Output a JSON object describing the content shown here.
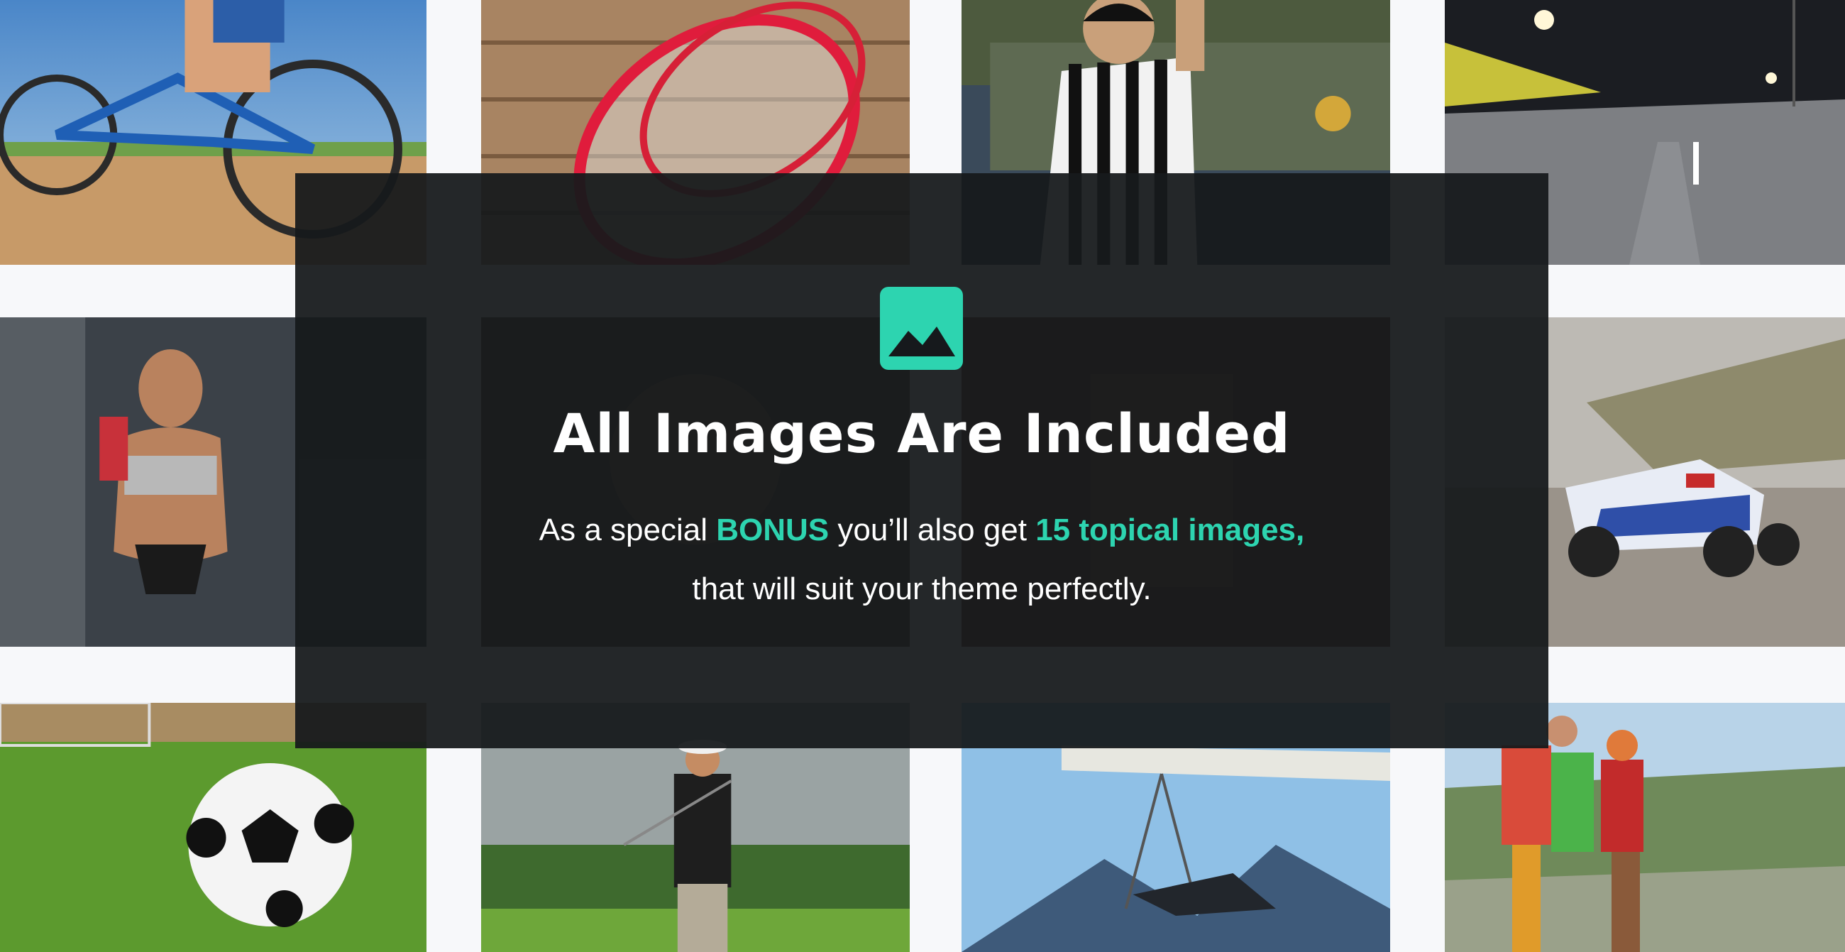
{
  "promo": {
    "icon": "image-icon",
    "headline": "All Images Are Included",
    "line1": {
      "part1": "As a special ",
      "bonus": "BONUS",
      "part2": " you’ll also get ",
      "count": "15 topical images,"
    },
    "line2": "that will suit your theme perfectly."
  },
  "gallery": [
    {
      "subject": "cycling-photo"
    },
    {
      "subject": "tennis-racket-photo"
    },
    {
      "subject": "referee-photo"
    },
    {
      "subject": "race-track-photo"
    },
    {
      "subject": "fitness-woman-photo"
    },
    {
      "subject": "hidden-photo-1"
    },
    {
      "subject": "hidden-photo-2"
    },
    {
      "subject": "rally-car-photo"
    },
    {
      "subject": "soccer-ball-photo"
    },
    {
      "subject": "golfer-photo"
    },
    {
      "subject": "hang-glider-photo"
    },
    {
      "subject": "hikers-photo"
    }
  ],
  "colors": {
    "accent": "#2dd4b0",
    "overlay": "#16191c",
    "background": "#f7f8fa"
  }
}
